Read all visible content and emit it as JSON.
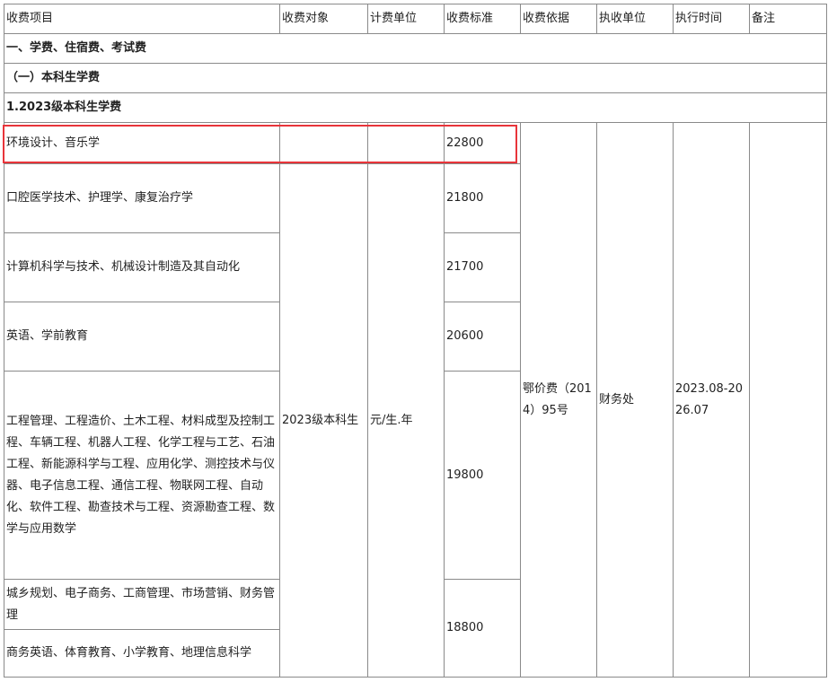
{
  "headers": [
    "收费项目",
    "收费对象",
    "计费单位",
    "收费标准",
    "收费依据",
    "执收单位",
    "执行时间",
    "备注"
  ],
  "sections": {
    "level1": "一、学费、住宿费、考试费",
    "level2": "（一）本科生学费",
    "level3": "1.2023级本科生学费"
  },
  "rows": [
    {
      "majors": "环境设计、音乐学",
      "fee": "22800"
    },
    {
      "majors": "口腔医学技术、护理学、康复治疗学",
      "fee": "21800"
    },
    {
      "majors": "计算机科学与技术、机械设计制造及其自动化",
      "fee": "21700"
    },
    {
      "majors": "英语、学前教育",
      "fee": "20600"
    },
    {
      "majors": "工程管理、工程造价、土木工程、材料成型及控制工程、车辆工程、机器人工程、化学工程与工艺、石油工程、新能源科学与工程、应用化学、测控技术与仪器、电子信息工程、通信工程、物联网工程、自动化、软件工程、勘查技术与工程、资源勘查工程、数学与应用数学",
      "fee": "19800"
    },
    {
      "majors": "城乡规划、电子商务、工商管理、市场营销、财务管理",
      "fee": "18800"
    },
    {
      "majors": "商务英语、体育教育、小学教育、地理信息科学",
      "fee": ""
    }
  ],
  "shared": {
    "target": "2023级本科生",
    "unit": "元/生.年",
    "basis": "鄂价费（2014）95号",
    "collector": "财务处",
    "period": "2023.08-2026.07",
    "remark": ""
  },
  "highlight_color": "#e8343a"
}
